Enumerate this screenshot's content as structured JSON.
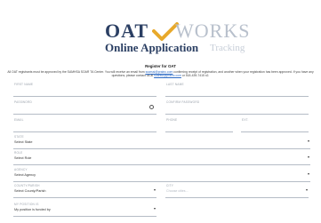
{
  "brand": {
    "logo_main": "OAT",
    "logo_works": "WORKS",
    "subtitle": "Online Application",
    "subtitle_light": "Tracking",
    "check_color": "#e8a92b"
  },
  "form": {
    "title": "Register for OAT",
    "notice_part1": "All OAT registrants must be approved by the SAMHSA SOAR TA Center. You will receive an email from ",
    "notice_link1": "soarssi@prainc.com",
    "notice_part2": " confirming receipt of registration, and another when your registration has been approved. If you have any questions, please contact us at ",
    "notice_link2": "soarssi@prainc.com",
    "notice_part3": " or 518-439-7415 x2.",
    "fields": {
      "first_name": {
        "label": "FIRST NAME"
      },
      "last_name": {
        "label": "LAST NAME"
      },
      "password": {
        "label": "PASSWORD"
      },
      "confirm_password": {
        "label": "CONFIRM PASSWORD"
      },
      "email": {
        "label": "EMAIL"
      },
      "phone": {
        "label": "PHONE"
      },
      "ext": {
        "label": "EXT."
      },
      "state": {
        "label": "STATE",
        "value": "Select State"
      },
      "role": {
        "label": "ROLE",
        "value": "Select Role"
      },
      "agency": {
        "label": "AGENCY",
        "value": "Select Agency"
      },
      "county": {
        "label": "COUNTY/PARISH",
        "value": "Select County/Parish"
      },
      "city": {
        "label": "CITY",
        "placeholder": "Choose cities..."
      },
      "position": {
        "label": "MY POSITION IS",
        "value": "My position is funded by"
      }
    }
  }
}
